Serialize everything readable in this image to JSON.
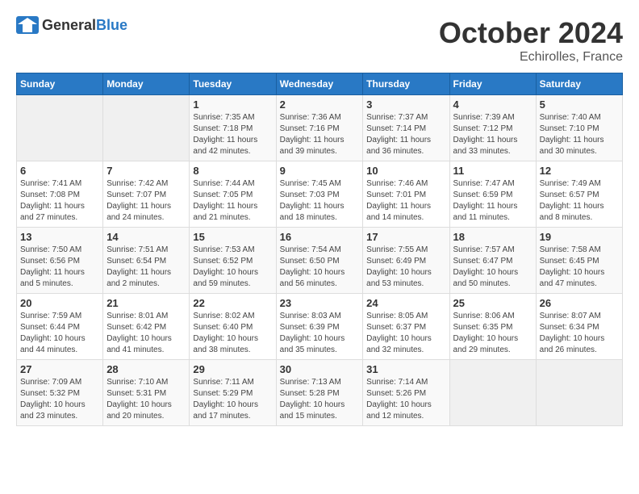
{
  "header": {
    "logo_general": "General",
    "logo_blue": "Blue",
    "month": "October 2024",
    "location": "Echirolles, France"
  },
  "days_of_week": [
    "Sunday",
    "Monday",
    "Tuesday",
    "Wednesday",
    "Thursday",
    "Friday",
    "Saturday"
  ],
  "weeks": [
    [
      {
        "day": "",
        "sunrise": "",
        "sunset": "",
        "daylight": ""
      },
      {
        "day": "",
        "sunrise": "",
        "sunset": "",
        "daylight": ""
      },
      {
        "day": "1",
        "sunrise": "Sunrise: 7:35 AM",
        "sunset": "Sunset: 7:18 PM",
        "daylight": "Daylight: 11 hours and 42 minutes."
      },
      {
        "day": "2",
        "sunrise": "Sunrise: 7:36 AM",
        "sunset": "Sunset: 7:16 PM",
        "daylight": "Daylight: 11 hours and 39 minutes."
      },
      {
        "day": "3",
        "sunrise": "Sunrise: 7:37 AM",
        "sunset": "Sunset: 7:14 PM",
        "daylight": "Daylight: 11 hours and 36 minutes."
      },
      {
        "day": "4",
        "sunrise": "Sunrise: 7:39 AM",
        "sunset": "Sunset: 7:12 PM",
        "daylight": "Daylight: 11 hours and 33 minutes."
      },
      {
        "day": "5",
        "sunrise": "Sunrise: 7:40 AM",
        "sunset": "Sunset: 7:10 PM",
        "daylight": "Daylight: 11 hours and 30 minutes."
      }
    ],
    [
      {
        "day": "6",
        "sunrise": "Sunrise: 7:41 AM",
        "sunset": "Sunset: 7:08 PM",
        "daylight": "Daylight: 11 hours and 27 minutes."
      },
      {
        "day": "7",
        "sunrise": "Sunrise: 7:42 AM",
        "sunset": "Sunset: 7:07 PM",
        "daylight": "Daylight: 11 hours and 24 minutes."
      },
      {
        "day": "8",
        "sunrise": "Sunrise: 7:44 AM",
        "sunset": "Sunset: 7:05 PM",
        "daylight": "Daylight: 11 hours and 21 minutes."
      },
      {
        "day": "9",
        "sunrise": "Sunrise: 7:45 AM",
        "sunset": "Sunset: 7:03 PM",
        "daylight": "Daylight: 11 hours and 18 minutes."
      },
      {
        "day": "10",
        "sunrise": "Sunrise: 7:46 AM",
        "sunset": "Sunset: 7:01 PM",
        "daylight": "Daylight: 11 hours and 14 minutes."
      },
      {
        "day": "11",
        "sunrise": "Sunrise: 7:47 AM",
        "sunset": "Sunset: 6:59 PM",
        "daylight": "Daylight: 11 hours and 11 minutes."
      },
      {
        "day": "12",
        "sunrise": "Sunrise: 7:49 AM",
        "sunset": "Sunset: 6:57 PM",
        "daylight": "Daylight: 11 hours and 8 minutes."
      }
    ],
    [
      {
        "day": "13",
        "sunrise": "Sunrise: 7:50 AM",
        "sunset": "Sunset: 6:56 PM",
        "daylight": "Daylight: 11 hours and 5 minutes."
      },
      {
        "day": "14",
        "sunrise": "Sunrise: 7:51 AM",
        "sunset": "Sunset: 6:54 PM",
        "daylight": "Daylight: 11 hours and 2 minutes."
      },
      {
        "day": "15",
        "sunrise": "Sunrise: 7:53 AM",
        "sunset": "Sunset: 6:52 PM",
        "daylight": "Daylight: 10 hours and 59 minutes."
      },
      {
        "day": "16",
        "sunrise": "Sunrise: 7:54 AM",
        "sunset": "Sunset: 6:50 PM",
        "daylight": "Daylight: 10 hours and 56 minutes."
      },
      {
        "day": "17",
        "sunrise": "Sunrise: 7:55 AM",
        "sunset": "Sunset: 6:49 PM",
        "daylight": "Daylight: 10 hours and 53 minutes."
      },
      {
        "day": "18",
        "sunrise": "Sunrise: 7:57 AM",
        "sunset": "Sunset: 6:47 PM",
        "daylight": "Daylight: 10 hours and 50 minutes."
      },
      {
        "day": "19",
        "sunrise": "Sunrise: 7:58 AM",
        "sunset": "Sunset: 6:45 PM",
        "daylight": "Daylight: 10 hours and 47 minutes."
      }
    ],
    [
      {
        "day": "20",
        "sunrise": "Sunrise: 7:59 AM",
        "sunset": "Sunset: 6:44 PM",
        "daylight": "Daylight: 10 hours and 44 minutes."
      },
      {
        "day": "21",
        "sunrise": "Sunrise: 8:01 AM",
        "sunset": "Sunset: 6:42 PM",
        "daylight": "Daylight: 10 hours and 41 minutes."
      },
      {
        "day": "22",
        "sunrise": "Sunrise: 8:02 AM",
        "sunset": "Sunset: 6:40 PM",
        "daylight": "Daylight: 10 hours and 38 minutes."
      },
      {
        "day": "23",
        "sunrise": "Sunrise: 8:03 AM",
        "sunset": "Sunset: 6:39 PM",
        "daylight": "Daylight: 10 hours and 35 minutes."
      },
      {
        "day": "24",
        "sunrise": "Sunrise: 8:05 AM",
        "sunset": "Sunset: 6:37 PM",
        "daylight": "Daylight: 10 hours and 32 minutes."
      },
      {
        "day": "25",
        "sunrise": "Sunrise: 8:06 AM",
        "sunset": "Sunset: 6:35 PM",
        "daylight": "Daylight: 10 hours and 29 minutes."
      },
      {
        "day": "26",
        "sunrise": "Sunrise: 8:07 AM",
        "sunset": "Sunset: 6:34 PM",
        "daylight": "Daylight: 10 hours and 26 minutes."
      }
    ],
    [
      {
        "day": "27",
        "sunrise": "Sunrise: 7:09 AM",
        "sunset": "Sunset: 5:32 PM",
        "daylight": "Daylight: 10 hours and 23 minutes."
      },
      {
        "day": "28",
        "sunrise": "Sunrise: 7:10 AM",
        "sunset": "Sunset: 5:31 PM",
        "daylight": "Daylight: 10 hours and 20 minutes."
      },
      {
        "day": "29",
        "sunrise": "Sunrise: 7:11 AM",
        "sunset": "Sunset: 5:29 PM",
        "daylight": "Daylight: 10 hours and 17 minutes."
      },
      {
        "day": "30",
        "sunrise": "Sunrise: 7:13 AM",
        "sunset": "Sunset: 5:28 PM",
        "daylight": "Daylight: 10 hours and 15 minutes."
      },
      {
        "day": "31",
        "sunrise": "Sunrise: 7:14 AM",
        "sunset": "Sunset: 5:26 PM",
        "daylight": "Daylight: 10 hours and 12 minutes."
      },
      {
        "day": "",
        "sunrise": "",
        "sunset": "",
        "daylight": ""
      },
      {
        "day": "",
        "sunrise": "",
        "sunset": "",
        "daylight": ""
      }
    ]
  ]
}
